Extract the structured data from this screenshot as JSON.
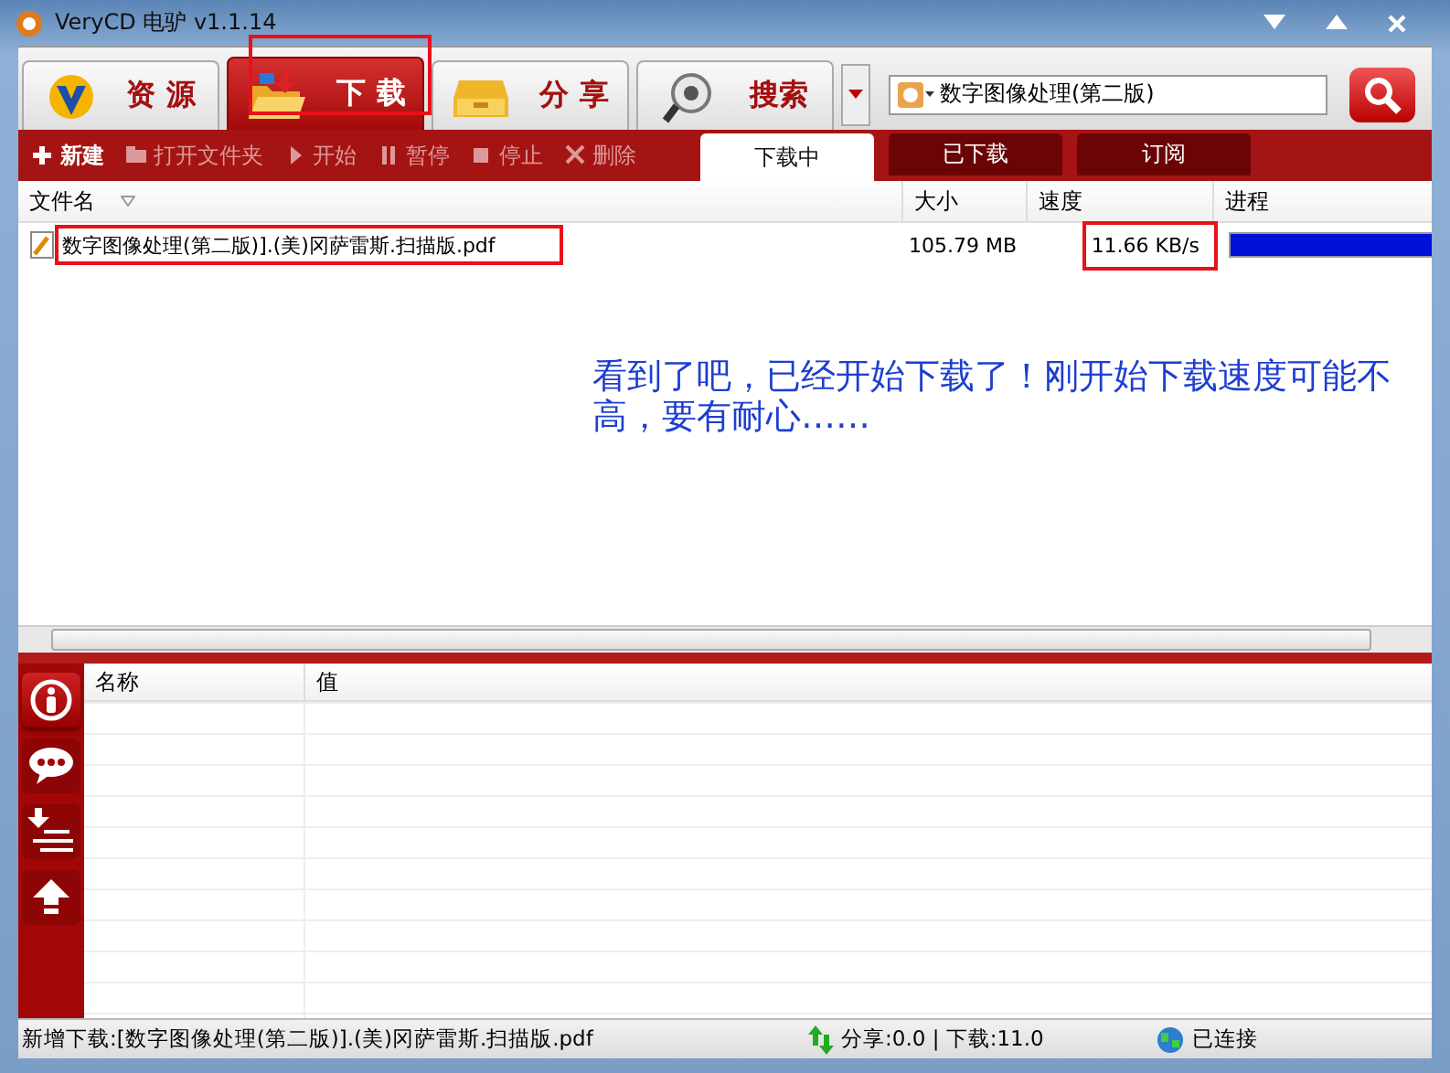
{
  "window": {
    "title": "VeryCD 电驴 v1.1.14"
  },
  "main_tabs": [
    {
      "label": "资 源",
      "selected": false,
      "highlighted": false
    },
    {
      "label": "下 载",
      "selected": true,
      "highlighted": true
    },
    {
      "label": "分 享",
      "selected": false,
      "highlighted": false
    },
    {
      "label": "搜索",
      "selected": false,
      "highlighted": false
    }
  ],
  "search": {
    "value": "数字图像处理(第二版)"
  },
  "toolbar": [
    {
      "label": "新建",
      "disabled": false
    },
    {
      "label": "打开文件夹",
      "disabled": true
    },
    {
      "label": "开始",
      "disabled": true
    },
    {
      "label": "暂停",
      "disabled": true
    },
    {
      "label": "停止",
      "disabled": true
    },
    {
      "label": "删除",
      "disabled": true
    }
  ],
  "sub_tabs": [
    {
      "label": "下载中",
      "selected": true
    },
    {
      "label": "已下载",
      "selected": false
    },
    {
      "label": "订阅",
      "selected": false
    }
  ],
  "downloads": {
    "columns": [
      "文件名",
      "大小",
      "速度",
      "进程"
    ],
    "rows": [
      {
        "name": "数字图像处理(第二版)].(美)冈萨雷斯.扫描版.pdf",
        "size": "105.79 MB",
        "speed": "11.66 KB/s",
        "level": 1,
        "name_highlighted": true,
        "speed_highlighted": true
      }
    ]
  },
  "note": "看到了吧，已经开始下载了！刚开始下载速度可能不高，要有耐心……",
  "detail_sidebar": [
    {
      "kind": "info",
      "selected": true
    },
    {
      "kind": "comment",
      "selected": false
    },
    {
      "kind": "download-list",
      "selected": false
    },
    {
      "kind": "upload",
      "selected": false
    }
  ],
  "detail_table": {
    "columns": [
      "名称",
      "值"
    ]
  },
  "status_bar": {
    "message": "新增下载:[数字图像处理(第二版)].(美)冈萨雷斯.扫描版.pdf",
    "traffic": "分享:0.0 | 下载:11.0",
    "connection": "已连接"
  }
}
